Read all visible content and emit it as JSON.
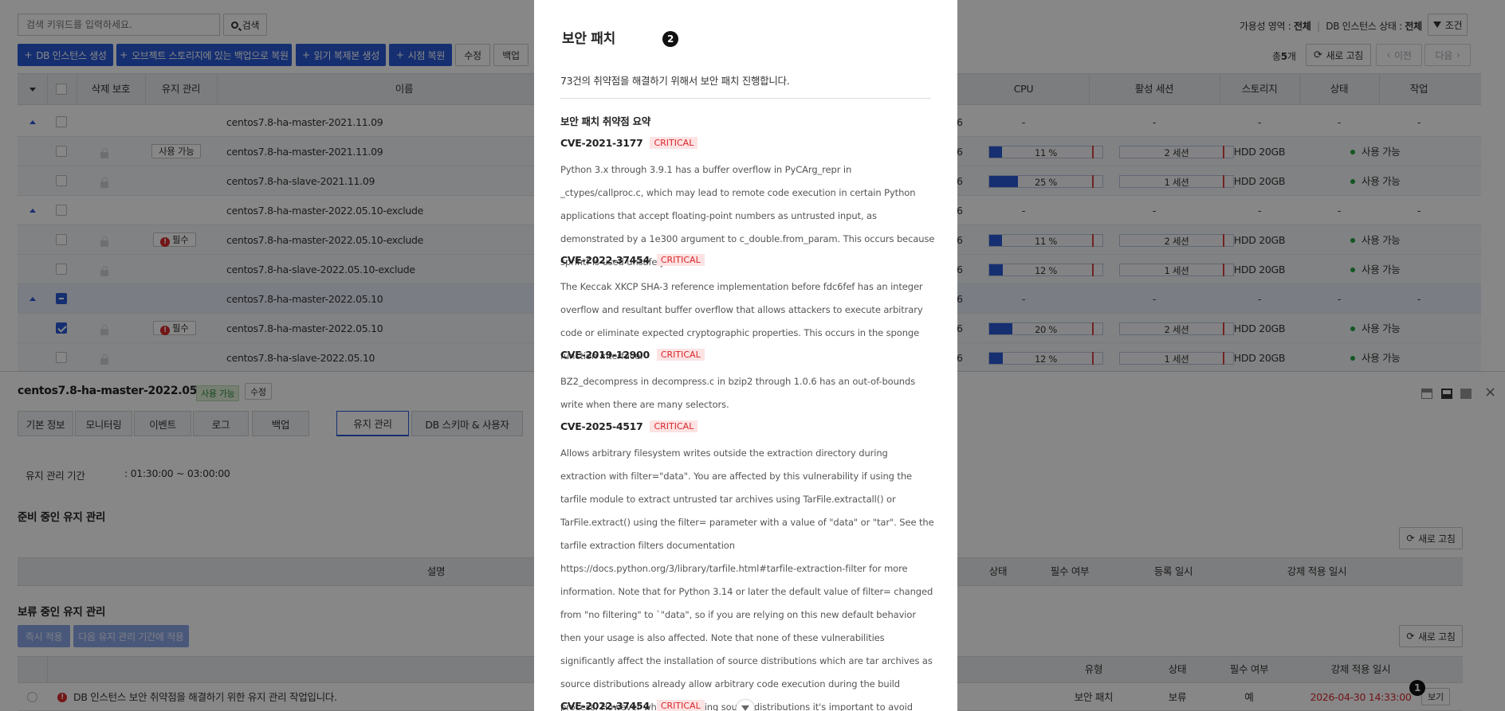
{
  "search": {
    "placeholder": "검색 키워드를 입력하세요.",
    "button": "검색"
  },
  "filters": {
    "zone_label": "가용성 영역 :",
    "zone_value": "전체",
    "state_label": "DB 인스턴스 상태 :",
    "state_value": "전체",
    "condition_button": "조건"
  },
  "toolbar": {
    "create_instance": "DB 인스턴스 생성",
    "restore_object_storage": "오브젝트 스토리지에 있는 백업으로 복원",
    "create_read_replica": "읽기 복제본 생성",
    "pitr": "시점 복원",
    "edit": "수정",
    "backup": "백업",
    "total_prefix": "총",
    "total_count": "5",
    "total_suffix": "개",
    "refresh": "새로 고침",
    "prev": "이전",
    "next": "다음"
  },
  "table": {
    "headers": {
      "delete_protect": "삭제 보호",
      "maintenance": "유지 관리",
      "name": "이름",
      "cpu": "CPU",
      "sessions": "활성 세션",
      "storage": "스토리지",
      "status": "상태",
      "action": "작업"
    },
    "rows": [
      {
        "kind": "group",
        "name": "centos7.8-ha-master-2021.11.09",
        "col6": "6",
        "cpu": "-",
        "sessions": "-",
        "storage": "-",
        "status": "-",
        "action": "-"
      },
      {
        "kind": "child",
        "maint": "사용 가능",
        "maint_type": "plain",
        "name": "centos7.8-ha-master-2021.11.09",
        "col6": "6",
        "cpu_label": "11 %",
        "cpu_pct": 11,
        "sess_label": "2 세션",
        "sess_frac": 0,
        "storage": "HDD 20GB",
        "status": "사용 가능"
      },
      {
        "kind": "child",
        "name": "centos7.8-ha-slave-2021.11.09",
        "col6": "6",
        "cpu_label": "25 %",
        "cpu_pct": 25,
        "sess_label": "1 세션",
        "sess_frac": 0,
        "storage": "HDD 20GB",
        "status": "사용 가능"
      },
      {
        "kind": "group",
        "name": "centos7.8-ha-master-2022.05.10-exclude",
        "col6": "6",
        "cpu": "-",
        "sessions": "-",
        "storage": "-",
        "status": "-",
        "action": "-"
      },
      {
        "kind": "child",
        "maint": "필수",
        "maint_type": "required",
        "name": "centos7.8-ha-master-2022.05.10-exclude",
        "col6": "6",
        "cpu_label": "11 %",
        "cpu_pct": 11,
        "sess_label": "2 세션",
        "sess_frac": 0,
        "storage": "HDD 20GB",
        "status": "사용 가능"
      },
      {
        "kind": "child",
        "name": "centos7.8-ha-slave-2022.05.10-exclude",
        "col6": "6",
        "cpu_label": "12 %",
        "cpu_pct": 12,
        "sess_label": "1 세션",
        "sess_frac": 0,
        "storage": "HDD 20GB",
        "status": "사용 가능"
      },
      {
        "kind": "group-selected",
        "name": "centos7.8-ha-master-2022.05.10",
        "col6": "6",
        "cpu": "-",
        "sessions": "-",
        "storage": "-",
        "status": "-",
        "action": "-"
      },
      {
        "kind": "child-checked",
        "maint": "필수",
        "maint_type": "required",
        "name": "centos7.8-ha-master-2022.05.10",
        "col6": "6",
        "cpu_label": "20 %",
        "cpu_pct": 20,
        "sess_label": "2 세션",
        "sess_frac": 0,
        "storage": "HDD 20GB",
        "status": "사용 가능"
      },
      {
        "kind": "child",
        "name": "centos7.8-ha-slave-2022.05.10",
        "col6": "6",
        "cpu_label": "12 %",
        "cpu_pct": 12,
        "sess_label": "1 세션",
        "sess_frac": 0,
        "storage": "HDD 20GB",
        "status": "사용 가능"
      }
    ]
  },
  "detail": {
    "instance_name": "centos7.8-ha-master-2022.05.10",
    "status_badge": "사용 가능",
    "edit": "수정",
    "tabs": [
      "기본 정보",
      "모니터링",
      "이벤트",
      "로그",
      "백업",
      "유지 관리",
      "DB 스키마 & 사용자"
    ],
    "maint_window_label": "유지 관리 기간",
    "maint_window_value": ": 01:30:00 ~ 03:00:00",
    "pending_title": "준비 중인 유지 관리",
    "refresh": "새로 고침",
    "pending_headers": {
      "desc": "설명",
      "status": "상태",
      "required": "필수 여부",
      "registered": "등록 일시",
      "forced": "강제 적용 일시"
    },
    "deferred_title": "보류 중인 유지 관리",
    "apply_now": "즉시 적용",
    "apply_next": "다음 유지 관리 기간에 적용",
    "deferred_headers": {
      "type": "유형",
      "status": "상태",
      "required": "필수 여부",
      "forced": "강제 적용 일시"
    },
    "deferred_row": {
      "desc": "DB 인스턴스 보안 취약점을 해결하기 위한 유지 관리 작업입니다.",
      "type": "보안 패치",
      "status": "보류",
      "required": "예",
      "forced": "2026-04-30 14:33:00",
      "view": "보기"
    },
    "marker_1": "1"
  },
  "modal": {
    "title": "보안 패치",
    "marker_2": "2",
    "intro": "73건의 취약점을 해결하기 위해서 보안 패치 진행합니다.",
    "summary_title": "보안 패치 취약점 요약",
    "vulns": [
      {
        "id": "CVE-2021-3177",
        "severity": "CRITICAL",
        "desc": "Python 3.x through 3.9.1 has a buffer overflow in PyCArg_repr in _ctypes/callproc.c, which may lead to remote code execution in certain Python applications that accept floating-point numbers as untrusted input, as demonstrated by a 1e300 argument to c_double.from_param. This occurs because sprintf is used unsafely."
      },
      {
        "id": "CVE-2022-37454",
        "severity": "CRITICAL",
        "desc": "The Keccak XKCP SHA-3 reference implementation before fdc6fef has an integer overflow and resultant buffer overflow that allows attackers to execute arbitrary code or eliminate expected cryptographic properties. This occurs in the sponge function interface."
      },
      {
        "id": "CVE-2019-12900",
        "severity": "CRITICAL",
        "desc": "BZ2_decompress in decompress.c in bzip2 through 1.0.6 has an out-of-bounds write when there are many selectors."
      },
      {
        "id": "CVE-2025-4517",
        "severity": "CRITICAL",
        "desc": "Allows arbitrary filesystem writes outside the extraction directory during extraction with filter=\"data\". You are affected by this vulnerability if using the tarfile module to extract untrusted tar archives using TarFile.extractall() or TarFile.extract() using the filter= parameter with a value of \"data\" or \"tar\". See the tarfile extraction filters documentation https://docs.python.org/3/library/tarfile.html#tarfile-extraction-filter  for more information. Note that for Python 3.14 or later the default value of filter= changed from \"no filtering\" to `\"data\", so if you are relying on this new default behavior then your usage is also affected. Note that none of these vulnerabilities significantly affect the installation of source distributions which are tar archives as source distributions already allow arbitrary code execution during the build process. However when evaluating source distributions it's important to avoid installing source distributions with suspicious links."
      },
      {
        "id": "CVE-2022-37454",
        "severity": "CRITICAL",
        "desc": ""
      }
    ]
  }
}
